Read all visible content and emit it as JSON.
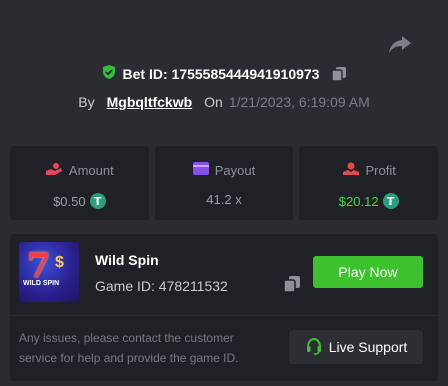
{
  "header": {
    "bet_id_label": "Bet ID: 1755585444941910973",
    "by_label": "By",
    "username": "Mgbqltfckwb",
    "on_label": "On",
    "date": "1/21/2023, 6:19:09 AM"
  },
  "stats": {
    "amount": {
      "label": "Amount",
      "value": "$0.50"
    },
    "payout": {
      "label": "Payout",
      "value": "41.2 x"
    },
    "profit": {
      "label": "Profit",
      "value": "$20.12"
    }
  },
  "game": {
    "title": "Wild Spin",
    "id_label": "Game ID: 478211532",
    "thumb_text": "WILD SPIN",
    "play_label": "Play Now"
  },
  "support": {
    "text": "Any issues, please contact the customer service for help and provide the game ID.",
    "button_label": "Live Support"
  },
  "colors": {
    "accent_green": "#3ec12e",
    "profit_green": "#4bd04b",
    "amount_icon": "#e8485e",
    "payout_icon": "#8a4df0",
    "profit_icon": "#e84848"
  },
  "icons": [
    "share-icon",
    "shield-check-icon",
    "copy-icon",
    "amount-icon",
    "payout-card-icon",
    "profit-icon",
    "tether-coin-icon",
    "headset-icon"
  ]
}
